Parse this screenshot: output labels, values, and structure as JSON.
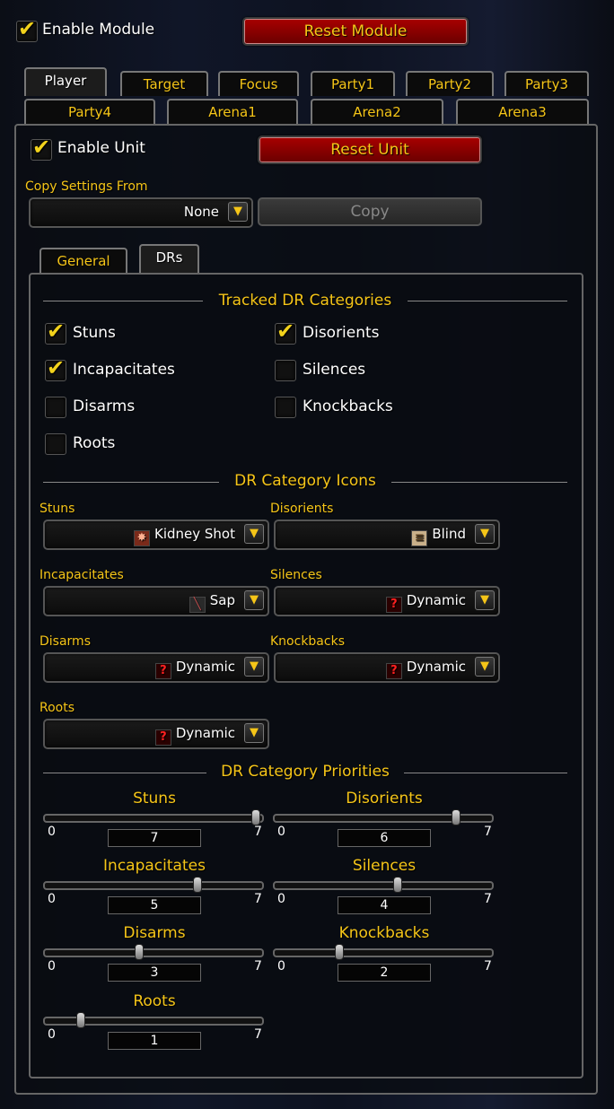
{
  "module": {
    "enable_label": "Enable Module",
    "enable_checked": true,
    "reset_label": "Reset Module"
  },
  "unit_tabs_row1": [
    "Player",
    "Target",
    "Focus",
    "Party1",
    "Party2",
    "Party3"
  ],
  "unit_tabs_row2": [
    "Party4",
    "Arena1",
    "Arena2",
    "Arena3"
  ],
  "active_unit_tab": "Player",
  "unit": {
    "enable_label": "Enable Unit",
    "enable_checked": true,
    "reset_label": "Reset Unit",
    "copy_from_label": "Copy Settings From",
    "copy_from_value": "None",
    "copy_button": "Copy"
  },
  "sub_tabs": [
    "General",
    "DRs"
  ],
  "active_sub_tab": "DRs",
  "tracked": {
    "header": "Tracked DR Categories",
    "items": [
      {
        "label": "Stuns",
        "checked": true
      },
      {
        "label": "Disorients",
        "checked": true
      },
      {
        "label": "Incapacitates",
        "checked": true
      },
      {
        "label": "Silences",
        "checked": false
      },
      {
        "label": "Disarms",
        "checked": false
      },
      {
        "label": "Knockbacks",
        "checked": false
      },
      {
        "label": "Roots",
        "checked": false
      }
    ]
  },
  "icons": {
    "header": "DR Category Icons",
    "items": [
      {
        "label": "Stuns",
        "value": "Kidney Shot",
        "icon": "kidney-shot-icon"
      },
      {
        "label": "Disorients",
        "value": "Blind",
        "icon": "blind-icon"
      },
      {
        "label": "Incapacitates",
        "value": "Sap",
        "icon": "sap-icon"
      },
      {
        "label": "Silences",
        "value": "Dynamic",
        "icon": "question-mark-icon"
      },
      {
        "label": "Disarms",
        "value": "Dynamic",
        "icon": "question-mark-icon"
      },
      {
        "label": "Knockbacks",
        "value": "Dynamic",
        "icon": "question-mark-icon"
      },
      {
        "label": "Roots",
        "value": "Dynamic",
        "icon": "question-mark-icon"
      }
    ]
  },
  "priorities": {
    "header": "DR Category Priorities",
    "min": "0",
    "max": "7",
    "items": [
      {
        "label": "Stuns",
        "value": "7"
      },
      {
        "label": "Disorients",
        "value": "6"
      },
      {
        "label": "Incapacitates",
        "value": "5"
      },
      {
        "label": "Silences",
        "value": "4"
      },
      {
        "label": "Disarms",
        "value": "3"
      },
      {
        "label": "Knockbacks",
        "value": "2"
      },
      {
        "label": "Roots",
        "value": "1"
      }
    ]
  },
  "colors": {
    "accent_gold": "#f5c518",
    "button_red": "#a80000",
    "check_yellow": "#f2d21c"
  }
}
